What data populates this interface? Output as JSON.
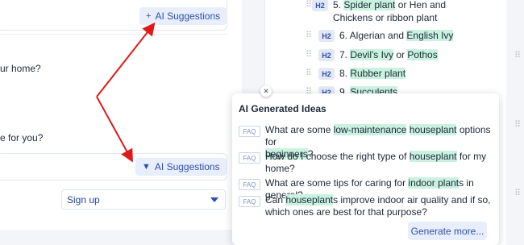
{
  "left_panel": {
    "ai_suggestions_top": {
      "icon": "plus-icon",
      "label": "AI Suggestions"
    },
    "question_1": "ur home?",
    "question_2": "e for you?",
    "ai_suggestions_bottom": {
      "icon": "caret-down-icon",
      "label": "AI Suggestions"
    },
    "signup_select": {
      "value": "Sign up"
    }
  },
  "outline": {
    "items": [
      {
        "badge": "H2",
        "prefix": "5. ",
        "parts": [
          {
            "text": "Spider plant",
            "hl": true
          },
          {
            "text": " or Hen and",
            "hl": false
          }
        ],
        "line2": "Chickens or ribbon plant"
      },
      {
        "badge": "H2",
        "prefix": "6. Algerian and ",
        "parts": [
          {
            "text": "English Ivy",
            "hl": true
          }
        ]
      },
      {
        "badge": "H2",
        "prefix": "7. ",
        "parts": [
          {
            "text": "Devil's Ivy",
            "hl": true
          },
          {
            "text": " or ",
            "hl": false
          },
          {
            "text": "Pothos",
            "hl": true
          }
        ]
      },
      {
        "badge": "H2",
        "prefix": "8. ",
        "parts": [
          {
            "text": "Rubber plant",
            "hl": true
          }
        ]
      },
      {
        "badge": "H2",
        "prefix": "9. ",
        "parts": [
          {
            "text": "Succulents",
            "hl": true
          }
        ]
      }
    ]
  },
  "popover": {
    "title": "AI Generated Ideas",
    "close_icon": "close-icon",
    "ideas": [
      {
        "badge": "FAQ",
        "line1": [
          {
            "text": "What are some ",
            "hl": false
          },
          {
            "text": "low-maintenance",
            "hl": true
          },
          {
            "text": " ",
            "hl": false
          },
          {
            "text": "houseplant",
            "hl": true
          },
          {
            "text": " options for",
            "hl": false
          }
        ],
        "line2": [
          {
            "text": "beginners",
            "hl": true
          },
          {
            "text": "?",
            "hl": false
          }
        ]
      },
      {
        "badge": "FAQ",
        "line1": [
          {
            "text": "How do I choose the right type of ",
            "hl": false
          },
          {
            "text": "houseplant",
            "hl": true
          },
          {
            "text": " for my",
            "hl": false
          }
        ],
        "line2": [
          {
            "text": "home?",
            "hl": false
          }
        ]
      },
      {
        "badge": "FAQ",
        "line1": [
          {
            "text": "What are some tips for caring for ",
            "hl": false
          },
          {
            "text": "indoor plant",
            "hl": true
          },
          {
            "text": "s in general?",
            "hl": false
          }
        ],
        "line2": []
      },
      {
        "badge": "FAQ",
        "line1": [
          {
            "text": "Can ",
            "hl": false
          },
          {
            "text": "houseplant",
            "hl": true
          },
          {
            "text": "s improve indoor air quality and if so,",
            "hl": false
          }
        ],
        "line2": [
          {
            "text": "which ones are best for that purpose?",
            "hl": false
          }
        ]
      }
    ],
    "generate_more": "Generate more..."
  },
  "colors": {
    "accent": "#2b4fb0",
    "highlight": "#c9f2e0",
    "annotation_arrow": "#e0191b"
  }
}
